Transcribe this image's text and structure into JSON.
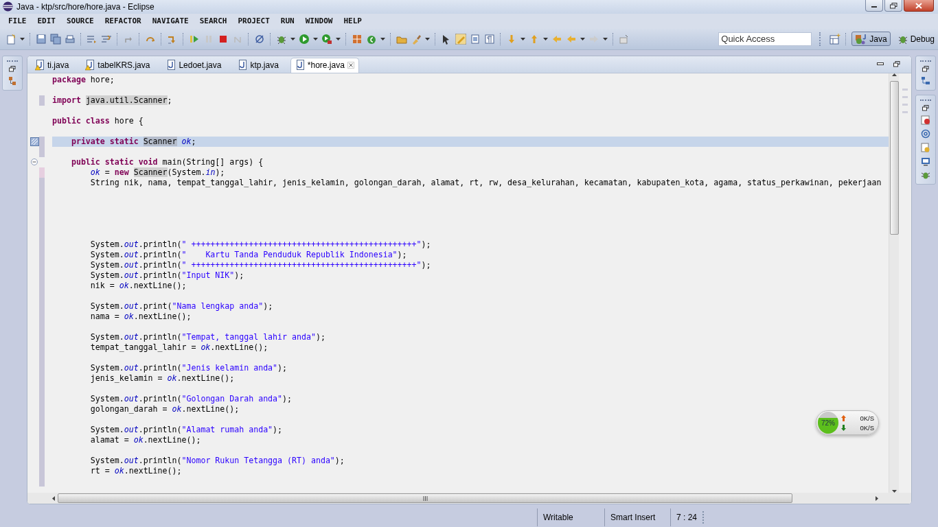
{
  "window": {
    "title": "Java - ktp/src/hore/hore.java - Eclipse"
  },
  "menu": [
    "FILE",
    "EDIT",
    "SOURCE",
    "REFACTOR",
    "NAVIGATE",
    "SEARCH",
    "PROJECT",
    "RUN",
    "WINDOW",
    "HELP"
  ],
  "quick_access": {
    "placeholder": "Quick Access"
  },
  "perspectives": [
    {
      "label": "Java",
      "selected": true
    },
    {
      "label": "Debug",
      "selected": false
    }
  ],
  "tabs": [
    {
      "label": "ti.java",
      "selected": false,
      "warning": true
    },
    {
      "label": "tabelKRS.java",
      "selected": false,
      "warning": true
    },
    {
      "label": "Ledoet.java",
      "selected": false,
      "warning": false
    },
    {
      "label": "ktp.java",
      "selected": false,
      "warning": false
    },
    {
      "label": "*hore.java",
      "selected": true,
      "warning": false
    }
  ],
  "code_lines": [
    {
      "kind": "code",
      "current": false,
      "tokens": [
        {
          "kind": "keyword",
          "text": "package"
        },
        {
          "kind": "plain",
          "text": " hore;"
        }
      ]
    },
    {
      "kind": "code",
      "current": false
    },
    {
      "kind": "code",
      "current": false,
      "color": "#c8c6d8",
      "tokens": [
        {
          "kind": "keyword",
          "text": "import "
        },
        {
          "kind": "occurrence",
          "text": "java.util.Scanner"
        },
        {
          "kind": "plain",
          "text": ";"
        }
      ]
    },
    {
      "kind": "code",
      "current": false
    },
    {
      "kind": "code",
      "current": false,
      "tokens": [
        {
          "kind": "keyword",
          "text": "public class"
        },
        {
          "kind": "plain",
          "text": " hore {"
        }
      ]
    },
    {
      "kind": "code",
      "current": false
    },
    {
      "kind": "occurrence_marker",
      "current": true,
      "color": "#c8c6d8",
      "tokens": [
        {
          "kind": "keyword",
          "text": "    private static "
        },
        {
          "kind": "occurrence",
          "text": "Scanner"
        },
        {
          "kind": "field",
          "text": " ok"
        },
        {
          "kind": "plain",
          "text": ";"
        }
      ]
    },
    {
      "kind": "code",
      "current": false,
      "color": "#c8c6d8"
    },
    {
      "kind": "fold",
      "current": false,
      "tokens": [
        {
          "kind": "keyword",
          "text": "    public static void"
        },
        {
          "kind": "plain",
          "text": " main(String[] args) {"
        }
      ]
    },
    {
      "kind": "code",
      "current": false,
      "color": "#e6cfe0",
      "tokens": [
        {
          "kind": "field",
          "text": "        ok"
        },
        {
          "kind": "plain",
          "text": " = "
        },
        {
          "kind": "keyword",
          "text": "new "
        },
        {
          "kind": "occurrence",
          "text": "Scanner"
        },
        {
          "kind": "plain",
          "text": "(System."
        },
        {
          "kind": "field",
          "text": "in"
        },
        {
          "kind": "plain",
          "text": ");"
        }
      ]
    },
    {
      "kind": "code",
      "current": false,
      "color": "#c8c6d8",
      "tokens": [
        {
          "kind": "plain",
          "text": "        String nik, nama, tempat_tanggal_lahir, jenis_kelamin, golongan_darah, alamat, rt, rw, desa_kelurahan, kecamatan, kabupaten_kota, agama, status_perkawinan, pekerjaan"
        }
      ]
    },
    {
      "kind": "code",
      "current": false,
      "color": "#c8c6d8"
    },
    {
      "kind": "code",
      "current": false,
      "color": "#c8c6d8"
    },
    {
      "kind": "code",
      "current": false,
      "color": "#c8c6d8"
    },
    {
      "kind": "code",
      "current": false,
      "color": "#c8c6d8"
    },
    {
      "kind": "code",
      "current": false,
      "color": "#c8c6d8"
    },
    {
      "kind": "code",
      "current": false,
      "color": "#c8c6d8",
      "tokens": [
        {
          "kind": "plain",
          "text": "        System."
        },
        {
          "kind": "field",
          "text": "out"
        },
        {
          "kind": "plain",
          "text": ".println("
        },
        {
          "kind": "string",
          "text": "\" +++++++++++++++++++++++++++++++++++++++++++++++\""
        },
        {
          "kind": "plain",
          "text": ");"
        }
      ]
    },
    {
      "kind": "code",
      "current": false,
      "color": "#c8c6d8",
      "tokens": [
        {
          "kind": "plain",
          "text": "        System."
        },
        {
          "kind": "field",
          "text": "out"
        },
        {
          "kind": "plain",
          "text": ".println("
        },
        {
          "kind": "string",
          "text": "\"    Kartu Tanda Penduduk Republik Indonesia\""
        },
        {
          "kind": "plain",
          "text": ");"
        }
      ]
    },
    {
      "kind": "code",
      "current": false,
      "color": "#c8c6d8",
      "tokens": [
        {
          "kind": "plain",
          "text": "        System."
        },
        {
          "kind": "field",
          "text": "out"
        },
        {
          "kind": "plain",
          "text": ".println("
        },
        {
          "kind": "string",
          "text": "\" +++++++++++++++++++++++++++++++++++++++++++++++\""
        },
        {
          "kind": "plain",
          "text": ");"
        }
      ]
    },
    {
      "kind": "code",
      "current": false,
      "color": "#c8c6d8",
      "tokens": [
        {
          "kind": "plain",
          "text": "        System."
        },
        {
          "kind": "field",
          "text": "out"
        },
        {
          "kind": "plain",
          "text": ".println("
        },
        {
          "kind": "string",
          "text": "\"Input NIK\""
        },
        {
          "kind": "plain",
          "text": ");"
        }
      ]
    },
    {
      "kind": "code",
      "current": false,
      "color": "#c8c6d8",
      "tokens": [
        {
          "kind": "plain",
          "text": "        nik = "
        },
        {
          "kind": "field",
          "text": "ok"
        },
        {
          "kind": "plain",
          "text": ".nextLine();"
        }
      ]
    },
    {
      "kind": "code",
      "current": false,
      "color": "#c8c6d8"
    },
    {
      "kind": "code",
      "current": false,
      "color": "#c8c6d8",
      "tokens": [
        {
          "kind": "plain",
          "text": "        System."
        },
        {
          "kind": "field",
          "text": "out"
        },
        {
          "kind": "plain",
          "text": ".print("
        },
        {
          "kind": "string",
          "text": "\"Nama lengkap anda\""
        },
        {
          "kind": "plain",
          "text": ");"
        }
      ]
    },
    {
      "kind": "code",
      "current": false,
      "color": "#c8c6d8",
      "tokens": [
        {
          "kind": "plain",
          "text": "        nama = "
        },
        {
          "kind": "field",
          "text": "ok"
        },
        {
          "kind": "plain",
          "text": ".nextLine();"
        }
      ]
    },
    {
      "kind": "code",
      "current": false,
      "color": "#c8c6d8"
    },
    {
      "kind": "code",
      "current": false,
      "color": "#c8c6d8",
      "tokens": [
        {
          "kind": "plain",
          "text": "        System."
        },
        {
          "kind": "field",
          "text": "out"
        },
        {
          "kind": "plain",
          "text": ".println("
        },
        {
          "kind": "string",
          "text": "\"Tempat, tanggal lahir anda\""
        },
        {
          "kind": "plain",
          "text": ");"
        }
      ]
    },
    {
      "kind": "code",
      "current": false,
      "color": "#c8c6d8",
      "tokens": [
        {
          "kind": "plain",
          "text": "        tempat_tanggal_lahir = "
        },
        {
          "kind": "field",
          "text": "ok"
        },
        {
          "kind": "plain",
          "text": ".nextLine();"
        }
      ]
    },
    {
      "kind": "code",
      "current": false,
      "color": "#c8c6d8"
    },
    {
      "kind": "code",
      "current": false,
      "color": "#c8c6d8",
      "tokens": [
        {
          "kind": "plain",
          "text": "        System."
        },
        {
          "kind": "field",
          "text": "out"
        },
        {
          "kind": "plain",
          "text": ".println("
        },
        {
          "kind": "string",
          "text": "\"Jenis kelamin anda\""
        },
        {
          "kind": "plain",
          "text": ");"
        }
      ]
    },
    {
      "kind": "code",
      "current": false,
      "color": "#c8c6d8",
      "tokens": [
        {
          "kind": "plain",
          "text": "        jenis_kelamin = "
        },
        {
          "kind": "field",
          "text": "ok"
        },
        {
          "kind": "plain",
          "text": ".nextLine();"
        }
      ]
    },
    {
      "kind": "code",
      "current": false,
      "color": "#c8c6d8"
    },
    {
      "kind": "code",
      "current": false,
      "color": "#c8c6d8",
      "tokens": [
        {
          "kind": "plain",
          "text": "        System."
        },
        {
          "kind": "field",
          "text": "out"
        },
        {
          "kind": "plain",
          "text": ".println("
        },
        {
          "kind": "string",
          "text": "\"Golongan Darah anda\""
        },
        {
          "kind": "plain",
          "text": ");"
        }
      ]
    },
    {
      "kind": "code",
      "current": false,
      "color": "#c8c6d8",
      "tokens": [
        {
          "kind": "plain",
          "text": "        golongan_darah = "
        },
        {
          "kind": "field",
          "text": "ok"
        },
        {
          "kind": "plain",
          "text": ".nextLine();"
        }
      ]
    },
    {
      "kind": "code",
      "current": false,
      "color": "#c8c6d8"
    },
    {
      "kind": "code",
      "current": false,
      "color": "#c8c6d8",
      "tokens": [
        {
          "kind": "plain",
          "text": "        System."
        },
        {
          "kind": "field",
          "text": "out"
        },
        {
          "kind": "plain",
          "text": ".println("
        },
        {
          "kind": "string",
          "text": "\"Alamat rumah anda\""
        },
        {
          "kind": "plain",
          "text": ");"
        }
      ]
    },
    {
      "kind": "code",
      "current": false,
      "color": "#c8c6d8",
      "tokens": [
        {
          "kind": "plain",
          "text": "        alamat = "
        },
        {
          "kind": "field",
          "text": "ok"
        },
        {
          "kind": "plain",
          "text": ".nextLine();"
        }
      ]
    },
    {
      "kind": "code",
      "current": false,
      "color": "#c8c6d8"
    },
    {
      "kind": "code",
      "current": false,
      "color": "#c8c6d8",
      "tokens": [
        {
          "kind": "plain",
          "text": "        System."
        },
        {
          "kind": "field",
          "text": "out"
        },
        {
          "kind": "plain",
          "text": ".println("
        },
        {
          "kind": "string",
          "text": "\"Nomor Rukun Tetangga (RT) anda\""
        },
        {
          "kind": "plain",
          "text": ");"
        }
      ]
    },
    {
      "kind": "code",
      "current": false,
      "color": "#c8c6d8",
      "tokens": [
        {
          "kind": "plain",
          "text": "        rt = "
        },
        {
          "kind": "field",
          "text": "ok"
        },
        {
          "kind": "plain",
          "text": ".nextLine();"
        }
      ]
    },
    {
      "kind": "code",
      "current": false,
      "color": "#c8c6d8"
    }
  ],
  "status_bar": [
    "Writable",
    "Smart Insert",
    "7 : 24"
  ],
  "net_meter": {
    "level": 0.72,
    "percent": "72%",
    "upload": "0K/S",
    "download": "0K/S"
  }
}
